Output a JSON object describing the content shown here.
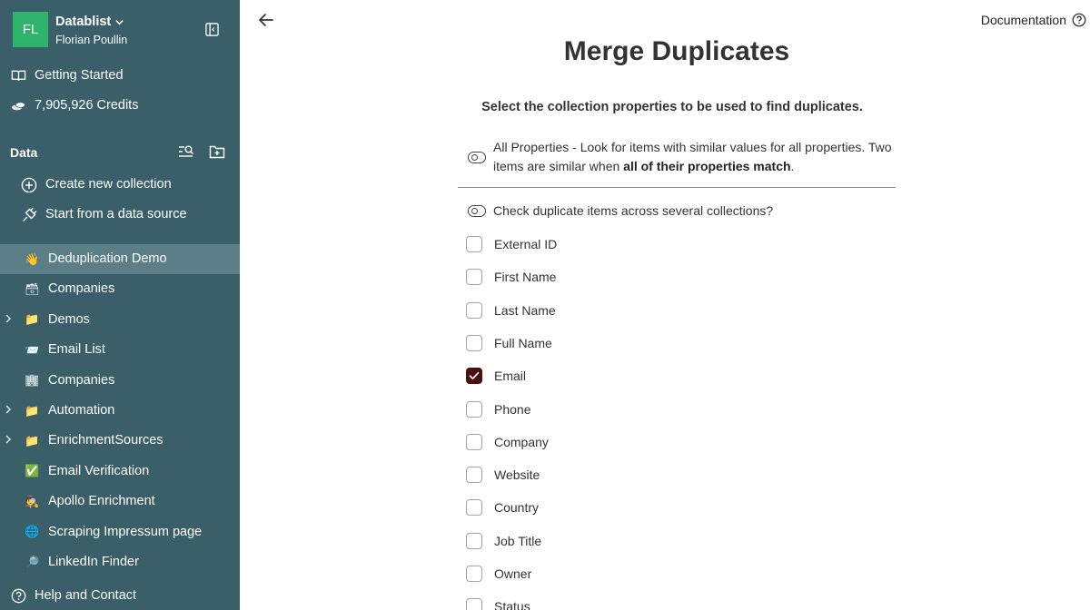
{
  "workspace": {
    "initials": "FL",
    "name": "Datablist",
    "user": "Florian Poullin"
  },
  "nav": {
    "getting_started": "Getting Started",
    "credits": "7,905,926 Credits",
    "data_section": "Data",
    "create_collection": "Create new collection",
    "start_source": "Start from a data source",
    "help": "Help and Contact"
  },
  "collections": [
    {
      "label": "Deduplication Demo",
      "emoji": "👋",
      "active": true,
      "expandable": false
    },
    {
      "label": "Companies",
      "emoji": "🗃",
      "active": false,
      "expandable": false
    },
    {
      "label": "Demos",
      "emoji": "📁",
      "active": false,
      "expandable": true
    },
    {
      "label": "Email List",
      "emoji": "📨",
      "active": false,
      "expandable": false
    },
    {
      "label": "Companies",
      "emoji": "🏢",
      "active": false,
      "expandable": false
    },
    {
      "label": "Automation",
      "emoji": "📁",
      "active": false,
      "expandable": true
    },
    {
      "label": "EnrichmentSources",
      "emoji": "📁",
      "active": false,
      "expandable": true
    },
    {
      "label": "Email Verification",
      "emoji": "✅",
      "active": false,
      "expandable": false
    },
    {
      "label": "Apollo Enrichment",
      "emoji": "🕵",
      "active": false,
      "expandable": false
    },
    {
      "label": "Scraping Impressum page",
      "emoji": "🌐",
      "active": false,
      "expandable": false
    },
    {
      "label": "LinkedIn Finder",
      "emoji": "🔎",
      "active": false,
      "expandable": false
    }
  ],
  "header": {
    "documentation": "Documentation"
  },
  "page": {
    "title": "Merge Duplicates",
    "subtitle": "Select the collection properties to be used to find duplicates.",
    "all_props_text": "All Properties - Look for items with similar values for all properties. Two items are similar when ",
    "all_props_bold": "all of their properties match",
    "all_props_end": ".",
    "across_collections": "Check duplicate items across several collections?"
  },
  "properties": [
    {
      "label": "External ID",
      "checked": false
    },
    {
      "label": "First Name",
      "checked": false
    },
    {
      "label": "Last Name",
      "checked": false
    },
    {
      "label": "Full Name",
      "checked": false
    },
    {
      "label": "Email",
      "checked": true
    },
    {
      "label": "Phone",
      "checked": false
    },
    {
      "label": "Company",
      "checked": false
    },
    {
      "label": "Website",
      "checked": false
    },
    {
      "label": "Country",
      "checked": false
    },
    {
      "label": "Job Title",
      "checked": false
    },
    {
      "label": "Owner",
      "checked": false
    },
    {
      "label": "Status",
      "checked": false
    }
  ],
  "colors": {
    "sidebar_bg": "#3a5f69",
    "avatar_bg": "#2eb36a",
    "active_row": "#5b7e87",
    "checkbox_checked": "#4c0f0f"
  }
}
